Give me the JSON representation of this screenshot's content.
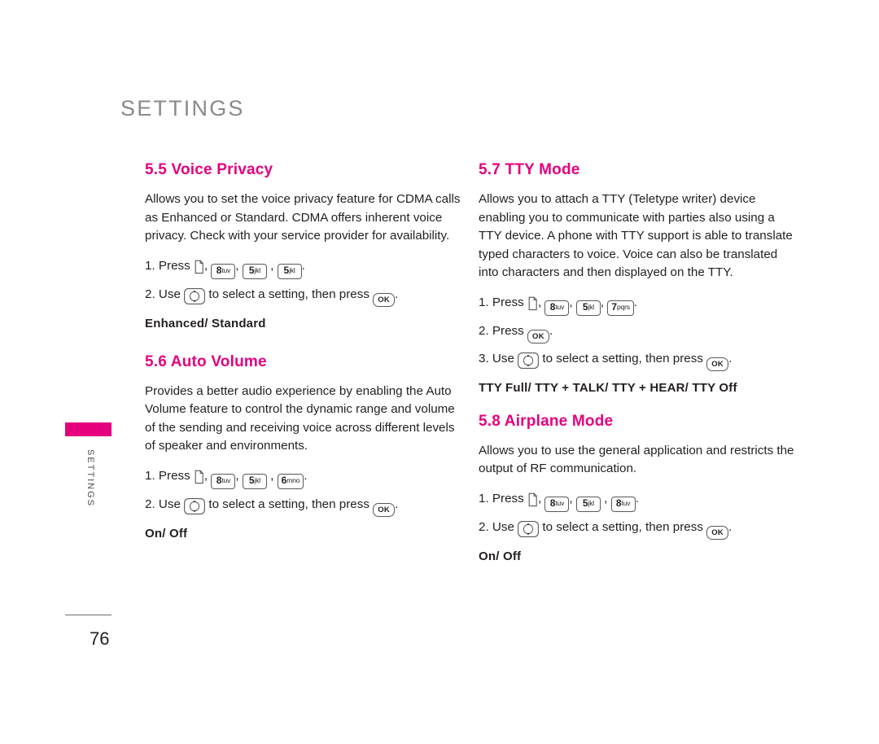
{
  "document": {
    "chapter_title": "SETTINGS",
    "side_tab_label": "SETTINGS",
    "page_number": "76"
  },
  "sections": {
    "voice_privacy": {
      "heading": "5.5 Voice Privacy",
      "body": "Allows you to set the voice privacy feature for CDMA calls as Enhanced or Standard. CDMA offers inherent voice privacy. Check with your service provider for availability.",
      "step1_prefix": "1. Press",
      "step1_comma1": ",",
      "step1_comma2": ",",
      "step1_end": ".",
      "step2_prefix": "2. Use",
      "step2_mid": "to select a setting, then press",
      "step2_end": ".",
      "options": "Enhanced/ Standard",
      "keys": [
        "8 tuv",
        "5 jkl",
        "5 jkl"
      ]
    },
    "auto_volume": {
      "heading": "5.6 Auto Volume",
      "body": "Provides a better audio experience by enabling the Auto Volume feature to control the dynamic range and volume of the sending and receiving voice across different levels of speaker and environments.",
      "step1_prefix": "1. Press",
      "step1_comma1": ",",
      "step1_comma2": ",",
      "step1_end": ".",
      "step2_prefix": "2. Use",
      "step2_mid": "to select a setting, then press",
      "step2_end": ".",
      "options": "On/ Off",
      "keys": [
        "8 tuv",
        "5 jkl",
        "6 mno"
      ]
    },
    "tty_mode": {
      "heading": "5.7 TTY Mode",
      "body": "Allows you to attach a TTY (Teletype writer) device enabling you to communicate with parties also using a TTY device. A phone with TTY support is able to translate typed characters to voice. Voice can also be translated into characters and then displayed on the TTY.",
      "step1_prefix": "1. Press",
      "step1_comma1": ",",
      "step1_comma2": ",",
      "step1_comma3": ",",
      "step1_end": ".",
      "step2_prefix": "2. Press",
      "step2_end": ".",
      "step3_prefix": "3. Use",
      "step3_mid": "to select a setting, then press",
      "step3_end": ".",
      "options": "TTY Full/ TTY + TALK/ TTY + HEAR/ TTY Off",
      "keys": [
        "8 tuv",
        "5 jkl",
        "7 pqrs"
      ]
    },
    "airplane_mode": {
      "heading": "5.8 Airplane Mode",
      "body": "Allows you to use the general application and restricts the output of RF communication.",
      "step1_prefix": "1. Press",
      "step1_comma1": ",",
      "step1_comma2": ",",
      "step1_end": ".",
      "step2_prefix": "2. Use",
      "step2_mid": "to select a setting, then press",
      "step2_end": ".",
      "options": "On/ Off",
      "keys": [
        "8 tuv",
        "5 jkl",
        "8 tuv"
      ]
    }
  },
  "keys": {
    "ok_label": "OK",
    "k8_num": "8",
    "k8_sub": "tuv",
    "k5_num": "5",
    "k5_sub": "jkl",
    "k6_num": "6",
    "k6_sub": "mno",
    "k7_num": "7",
    "k7_sub": "pqrs"
  },
  "colors": {
    "accent": "#e5007e",
    "text": "#231f20",
    "chapter": "#8a8a8a"
  }
}
